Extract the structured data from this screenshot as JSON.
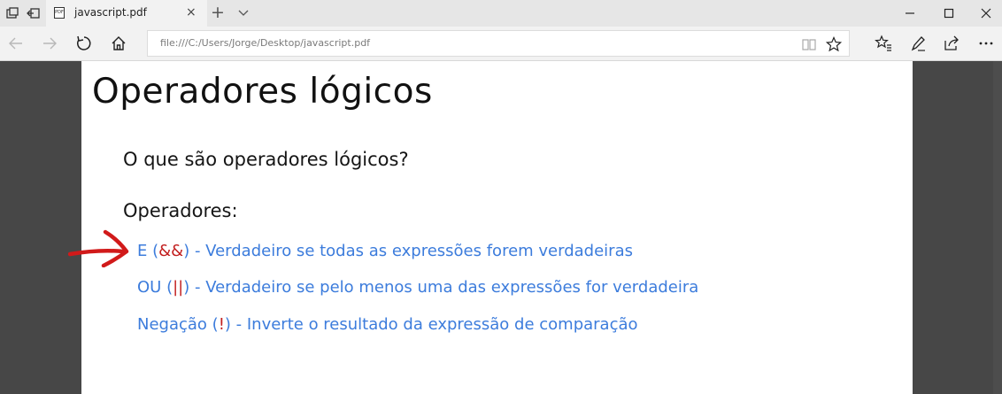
{
  "browser": {
    "tab_title": "javascript.pdf",
    "favicon_text": "PDF",
    "url": "file:///C:/Users/Jorge/Desktop/javascript.pdf",
    "icons": {
      "tab_sets": "tabs-icon",
      "back_tabs": "set-aside-tabs-icon",
      "tab_close": "×",
      "new_tab": "+"
    }
  },
  "document": {
    "title": "Operadores lógicos",
    "question": "O que são operadores lógicos?",
    "operators_heading": "Operadores:",
    "operators": [
      {
        "prefix": "E (",
        "symbol": "&&",
        "suffix": ") - Verdadeiro se todas as expressões forem verdadeiras"
      },
      {
        "prefix": "OU (",
        "symbol": "||",
        "suffix": ") - Verdadeiro se pelo menos uma das expressões for verdadeira"
      },
      {
        "prefix": "Negação (",
        "symbol": "!",
        "suffix": ") - Inverte o resultado da expressão de comparação"
      }
    ],
    "colors": {
      "operator_text": "#3c7cdc",
      "operator_symbol": "#c21f1f",
      "annotation_arrow": "#d11a1a"
    }
  }
}
